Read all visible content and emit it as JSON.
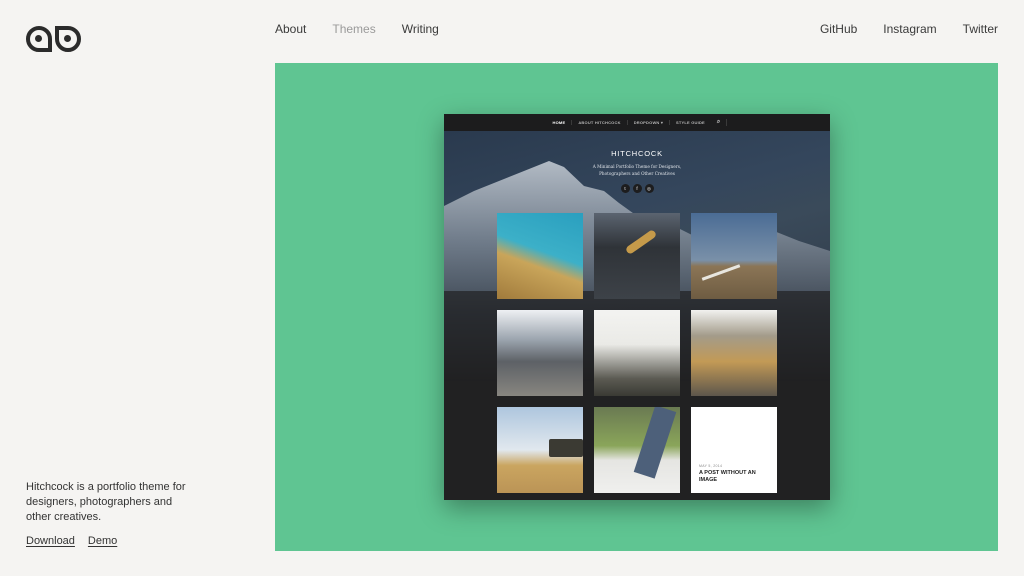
{
  "header": {
    "logo_icon": "owl-eyes-logo",
    "nav": [
      {
        "label": "About",
        "active": false
      },
      {
        "label": "Themes",
        "active": true
      },
      {
        "label": "Writing",
        "active": false
      }
    ],
    "social": [
      {
        "label": "GitHub"
      },
      {
        "label": "Instagram"
      },
      {
        "label": "Twitter"
      }
    ]
  },
  "intro": {
    "description": "Hitchcock is a portfolio theme for designers, photographers and other creatives.",
    "links": [
      {
        "label": "Download"
      },
      {
        "label": "Demo"
      }
    ]
  },
  "preview": {
    "accent_color": "#5fc592",
    "nav": {
      "items": [
        "HOME",
        "ABOUT HITCHCOCK",
        "DROPDOWN ▾",
        "STYLE GUIDE"
      ],
      "search_icon": "search-icon"
    },
    "hero": {
      "title": "HITCHCOCK",
      "subtitle_line1": "A Minimal Portfolio Theme for Designers,",
      "subtitle_line2": "Photographers and Other Creatives",
      "social_icons": [
        {
          "name": "twitter-icon",
          "glyph": "t"
        },
        {
          "name": "facebook-icon",
          "glyph": "f"
        },
        {
          "name": "instagram-icon",
          "glyph": "◎"
        }
      ]
    },
    "tiles": [
      {
        "subject": "aerial coastline"
      },
      {
        "subject": "swimmer"
      },
      {
        "subject": "desert road"
      },
      {
        "subject": "city skyline"
      },
      {
        "subject": "sunlit forest"
      },
      {
        "subject": "city skyscrapers"
      },
      {
        "subject": "old tv on dunes"
      },
      {
        "subject": "walking legs in park"
      },
      {
        "subject": "text post",
        "date": "MAY 5, 2014",
        "title": "A POST WITHOUT AN IMAGE"
      }
    ]
  }
}
